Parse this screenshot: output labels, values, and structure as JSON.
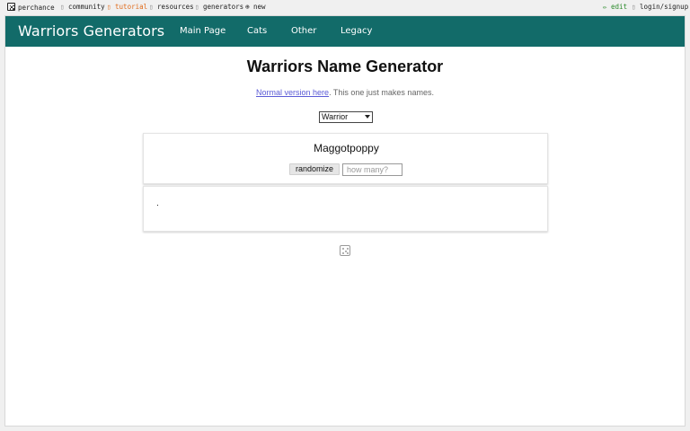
{
  "topbar": {
    "perchance": "perchance",
    "community": "community",
    "tutorial": "tutorial",
    "resources": "resources",
    "generators": "generators",
    "new": "new",
    "edit": "edit",
    "login": "login/signup"
  },
  "nav": {
    "brand": "Warriors Generators",
    "links": [
      "Main Page",
      "Cats",
      "Other",
      "Legacy"
    ],
    "color": "#126b69"
  },
  "main": {
    "title": "Warriors Name Generator",
    "link_text": "Normal version here",
    "sub_text": ". This one just makes names.",
    "select_value": "Warrior",
    "result": "Maggotpoppy",
    "randomize_label": "randomize",
    "count_placeholder": "how many?",
    "second_card_text": "."
  }
}
